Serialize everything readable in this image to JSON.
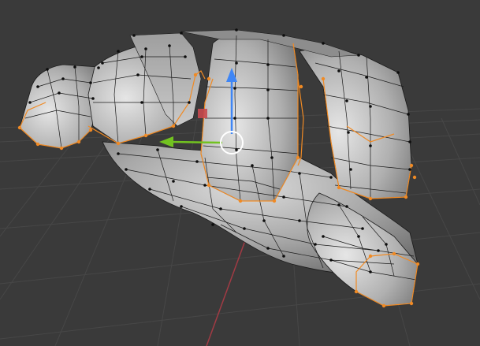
{
  "viewport": {
    "background": "#3a3a3a",
    "grid_line_color": "#474747",
    "x_axis_color": "#a13a44",
    "mode": "Edit Mode",
    "select_mode": "vertex"
  },
  "mesh": {
    "object_type": "hand",
    "surface_color": "#a9a9a9",
    "edge_color": "#1a1a1a",
    "vertex_color": "#0d0d0d",
    "selected_color": "#f08a24"
  },
  "gizmo": {
    "type": "move",
    "z_axis_color": "#3f86f5",
    "y_axis_color": "#72c220",
    "x_plane_handle_color": "#c8494f",
    "center_ring_color": "#ffffff"
  },
  "icons": [
    "move-gizmo-icon"
  ]
}
